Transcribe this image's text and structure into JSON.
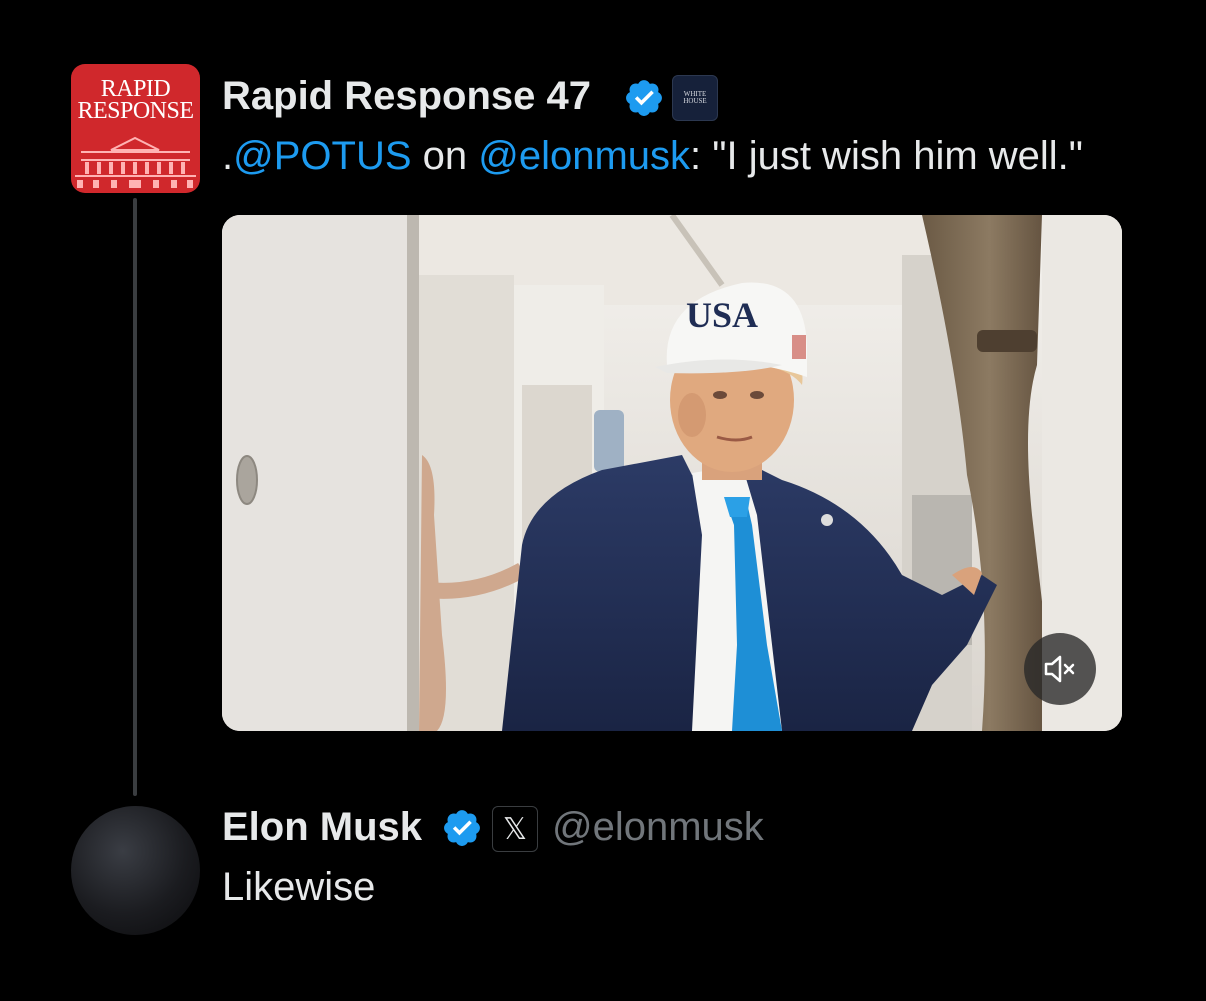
{
  "tweet": {
    "author_name": "Rapid Response 47",
    "avatar_lines": [
      "RAPID",
      "RESPONSE"
    ],
    "affiliation_badge_lines": [
      "WHITE",
      "HOUSE"
    ],
    "text_prefix": ".",
    "mention1": "@POTUS",
    "text_mid": " on ",
    "mention2": "@elonmusk",
    "text_suffix": ": \"I just wish him well.\"",
    "media": {
      "type": "video",
      "cap_text": "USA",
      "muted": true,
      "mute_icon": "speaker-muted-icon"
    }
  },
  "reply": {
    "author_name": "Elon Musk",
    "affiliation_badge": "𝕏",
    "handle": "@elonmusk",
    "text": "Likewise"
  },
  "colors": {
    "background": "#000000",
    "text": "#e7e9ea",
    "link": "#1d9bf0",
    "muted": "#71767b",
    "verified": "#1d9bf0",
    "avatar_red": "#d0282c"
  }
}
